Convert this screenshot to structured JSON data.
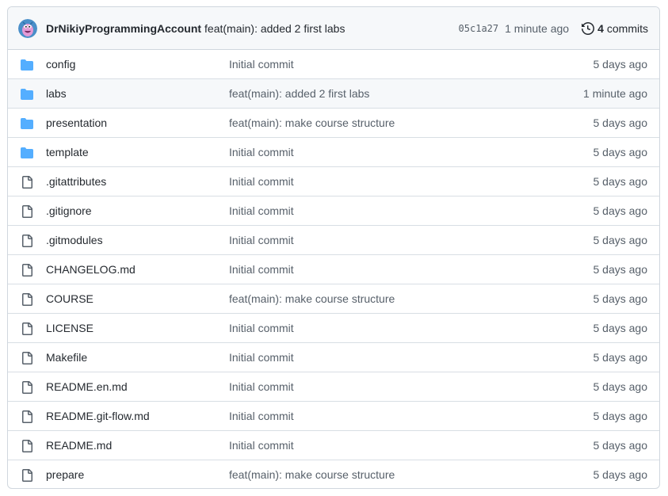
{
  "last_commit": {
    "author": "DrNikiyProgrammingAccount",
    "message": "feat(main): added 2 first labs",
    "sha": "05c1a27",
    "time": "1 minute ago",
    "commit_count": "4",
    "commits_label": "commits"
  },
  "colors": {
    "folder": "#54aeff",
    "file_icon": "#57606a",
    "border": "#d0d7de",
    "muted_text": "#57606a"
  },
  "files": [
    {
      "name": "config",
      "type": "folder",
      "message": "Initial commit",
      "date": "5 days ago"
    },
    {
      "name": "labs",
      "type": "folder",
      "message": "feat(main): added 2 first labs",
      "date": "1 minute ago"
    },
    {
      "name": "presentation",
      "type": "folder",
      "message": "feat(main): make course structure",
      "date": "5 days ago"
    },
    {
      "name": "template",
      "type": "folder",
      "message": "Initial commit",
      "date": "5 days ago"
    },
    {
      "name": ".gitattributes",
      "type": "file",
      "message": "Initial commit",
      "date": "5 days ago"
    },
    {
      "name": ".gitignore",
      "type": "file",
      "message": "Initial commit",
      "date": "5 days ago"
    },
    {
      "name": ".gitmodules",
      "type": "file",
      "message": "Initial commit",
      "date": "5 days ago"
    },
    {
      "name": "CHANGELOG.md",
      "type": "file",
      "message": "Initial commit",
      "date": "5 days ago"
    },
    {
      "name": "COURSE",
      "type": "file",
      "message": "feat(main): make course structure",
      "date": "5 days ago"
    },
    {
      "name": "LICENSE",
      "type": "file",
      "message": "Initial commit",
      "date": "5 days ago"
    },
    {
      "name": "Makefile",
      "type": "file",
      "message": "Initial commit",
      "date": "5 days ago"
    },
    {
      "name": "README.en.md",
      "type": "file",
      "message": "Initial commit",
      "date": "5 days ago"
    },
    {
      "name": "README.git-flow.md",
      "type": "file",
      "message": "Initial commit",
      "date": "5 days ago"
    },
    {
      "name": "README.md",
      "type": "file",
      "message": "Initial commit",
      "date": "5 days ago"
    },
    {
      "name": "prepare",
      "type": "file",
      "message": "feat(main): make course structure",
      "date": "5 days ago"
    }
  ]
}
